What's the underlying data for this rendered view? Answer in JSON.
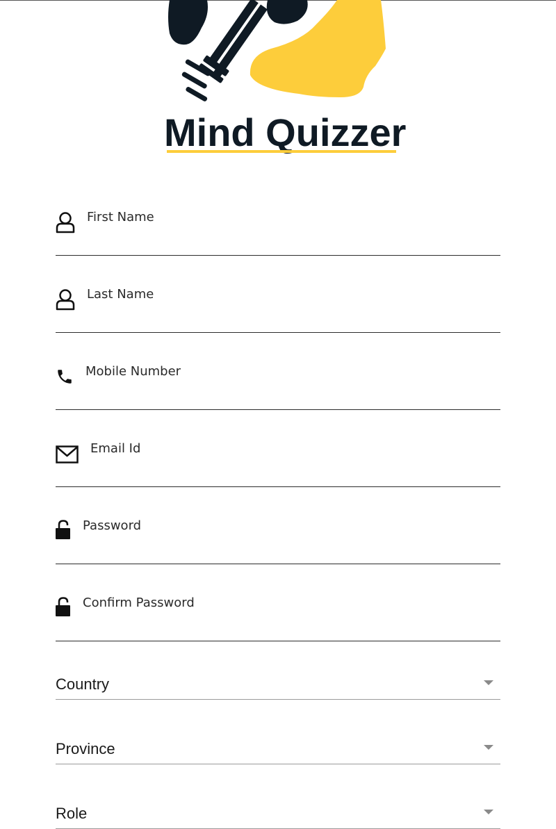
{
  "brand": {
    "name": "Mind Quizzer",
    "colors": {
      "dark": "#0f1a24",
      "accent": "#fdcd3b"
    }
  },
  "form": {
    "fields": [
      {
        "id": "first-name",
        "placeholder": "First Name",
        "icon": "user-icon"
      },
      {
        "id": "last-name",
        "placeholder": "Last Name",
        "icon": "user-icon"
      },
      {
        "id": "mobile-number",
        "placeholder": "Mobile Number",
        "icon": "phone-icon"
      },
      {
        "id": "email-id",
        "placeholder": "Email Id",
        "icon": "mail-icon"
      },
      {
        "id": "password",
        "placeholder": "Password",
        "icon": "unlock-icon"
      },
      {
        "id": "confirm-password",
        "placeholder": "Confirm Password",
        "icon": "unlock-icon"
      }
    ],
    "dropdowns": [
      {
        "id": "country",
        "label": "Country",
        "icon": "caret-down-icon"
      },
      {
        "id": "province",
        "label": "Province",
        "icon": "caret-down-icon"
      },
      {
        "id": "role",
        "label": "Role",
        "icon": "caret-down-icon"
      }
    ]
  }
}
